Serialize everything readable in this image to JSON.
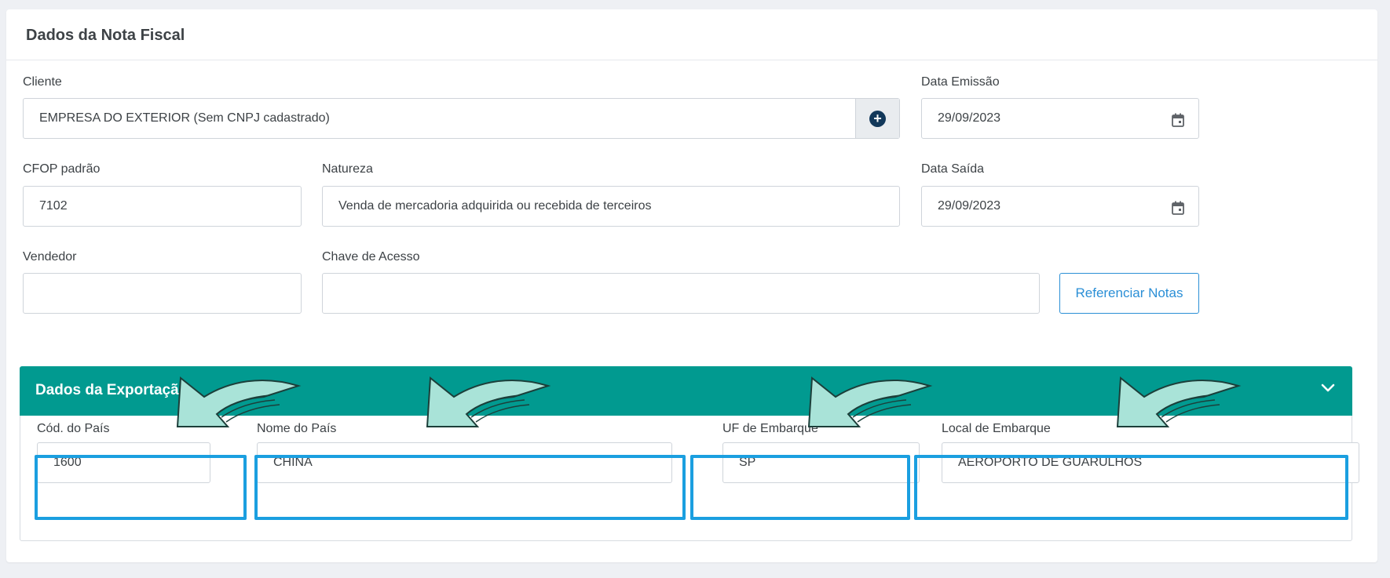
{
  "card": {
    "title": "Dados da Nota Fiscal"
  },
  "cliente": {
    "label": "Cliente",
    "value": "EMPRESA DO EXTERIOR (Sem CNPJ cadastrado)",
    "addon_icon": "plus-circle-icon"
  },
  "data_emissao": {
    "label": "Data Emissão",
    "value": "29/09/2023",
    "icon": "calendar-icon"
  },
  "cfop": {
    "label": "CFOP padrão",
    "value": "7102"
  },
  "natureza": {
    "label": "Natureza",
    "value": "Venda de mercadoria adquirida ou recebida de terceiros"
  },
  "data_saida": {
    "label": "Data Saída",
    "value": "29/09/2023",
    "icon": "calendar-icon"
  },
  "vendedor": {
    "label": "Vendedor",
    "value": ""
  },
  "chave_acesso": {
    "label": "Chave de Acesso",
    "value": ""
  },
  "referenciar_button": {
    "label": "Referenciar Notas"
  },
  "exportacao": {
    "title": "Dados da Exportação",
    "header_color": "#019a90",
    "toggle_icon": "chevron-down-icon",
    "cod_pais": {
      "label": "Cód. do País",
      "value": "1600"
    },
    "nome_pais": {
      "label": "Nome do País",
      "value": "CHINA"
    },
    "uf_embarque": {
      "label": "UF de Embarque",
      "value": "SP"
    },
    "local_embarque": {
      "label": "Local de Embarque",
      "value": "AEROPORTO DE GUARULHOS"
    }
  },
  "annotations": {
    "highlight_color": "#1b9fe0",
    "arrow_color": "#a9e3d8"
  }
}
